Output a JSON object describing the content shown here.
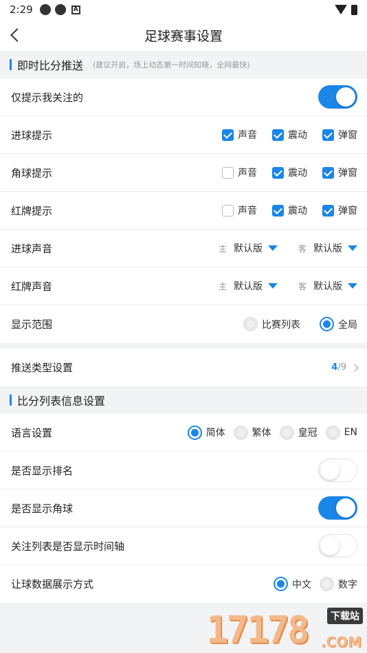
{
  "status": {
    "time": "2:29"
  },
  "header": {
    "title": "足球赛事设置"
  },
  "instant": {
    "section_title": "即时比分推送",
    "section_hint": "(建议开启，场上动态第一时间知晓，全网最快)",
    "only_followed": {
      "label": "仅提示我关注的",
      "on": true
    },
    "goal_alert": {
      "label": "进球提示",
      "options": [
        {
          "label": "声音",
          "checked": true
        },
        {
          "label": "震动",
          "checked": true
        },
        {
          "label": "弹窗",
          "checked": true
        }
      ]
    },
    "corner_alert": {
      "label": "角球提示",
      "options": [
        {
          "label": "声音",
          "checked": false
        },
        {
          "label": "震动",
          "checked": true
        },
        {
          "label": "弹窗",
          "checked": true
        }
      ]
    },
    "red_alert": {
      "label": "红牌提示",
      "options": [
        {
          "label": "声音",
          "checked": false
        },
        {
          "label": "震动",
          "checked": true
        },
        {
          "label": "弹窗",
          "checked": true
        }
      ]
    },
    "goal_sound": {
      "label": "进球声音",
      "home_prefix": "主",
      "home_value": "默认版",
      "away_prefix": "客",
      "away_value": "默认版"
    },
    "red_sound": {
      "label": "红牌声音",
      "home_prefix": "主",
      "home_value": "默认版",
      "away_prefix": "客",
      "away_value": "默认版"
    },
    "scope": {
      "label": "显示范围",
      "options": [
        {
          "label": "比赛列表",
          "selected": false
        },
        {
          "label": "全局",
          "selected": true
        }
      ]
    }
  },
  "push_type": {
    "label": "推送类型设置",
    "current": "4",
    "total": "/9"
  },
  "list_info": {
    "section_title": "比分列表信息设置",
    "language": {
      "label": "语言设置",
      "options": [
        {
          "label": "简体",
          "selected": true
        },
        {
          "label": "繁体",
          "selected": false
        },
        {
          "label": "皇冠",
          "selected": false
        },
        {
          "label": "EN",
          "selected": false
        }
      ]
    },
    "show_rank": {
      "label": "是否显示排名",
      "on": false
    },
    "show_corner": {
      "label": "是否显示角球",
      "on": true
    },
    "show_timeline": {
      "label": "关注列表是否显示时间轴",
      "on": false
    },
    "handicap_mode": {
      "label": "让球数据展示方式",
      "options": [
        {
          "label": "中文",
          "selected": true
        },
        {
          "label": "数字",
          "selected": false
        }
      ]
    }
  },
  "watermark": {
    "number": "17178",
    "badge": "下载站",
    "com": ".COM"
  },
  "colors": {
    "accent": "#1a86e8",
    "background": "#f2f3f5"
  }
}
